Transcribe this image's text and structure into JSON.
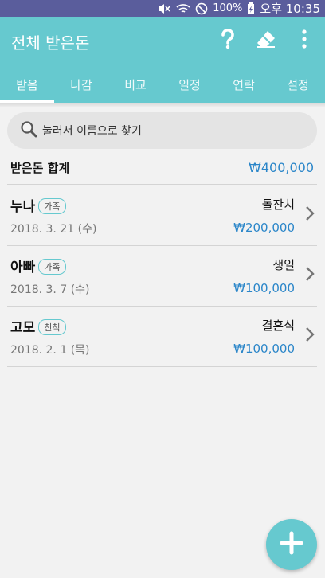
{
  "status_bar": {
    "battery": "100%",
    "time": "오후 10:35"
  },
  "app_bar": {
    "title": "전체 받은돈"
  },
  "tabs": [
    {
      "label": "받음",
      "active": true
    },
    {
      "label": "나감",
      "active": false
    },
    {
      "label": "비교",
      "active": false
    },
    {
      "label": "일정",
      "active": false
    },
    {
      "label": "연락",
      "active": false
    },
    {
      "label": "설정",
      "active": false
    }
  ],
  "search": {
    "placeholder": "눌러서 이름으로 찾기"
  },
  "summary": {
    "label": "받은돈 합계",
    "amount": "₩400,000"
  },
  "entries": [
    {
      "name": "누나",
      "tag": "가족",
      "date": "2018. 3. 21 (수)",
      "event": "돌잔치",
      "amount": "₩200,000"
    },
    {
      "name": "아빠",
      "tag": "가족",
      "date": "2018. 3. 7 (수)",
      "event": "생일",
      "amount": "₩100,000"
    },
    {
      "name": "고모",
      "tag": "친척",
      "date": "2018. 2. 1 (목)",
      "event": "결혼식",
      "amount": "₩100,000"
    }
  ],
  "colors": {
    "primary": "#66c9cf",
    "status_bar": "#5a5d9c",
    "amount_blue": "#2b86c9",
    "background": "#f2f2f2"
  }
}
